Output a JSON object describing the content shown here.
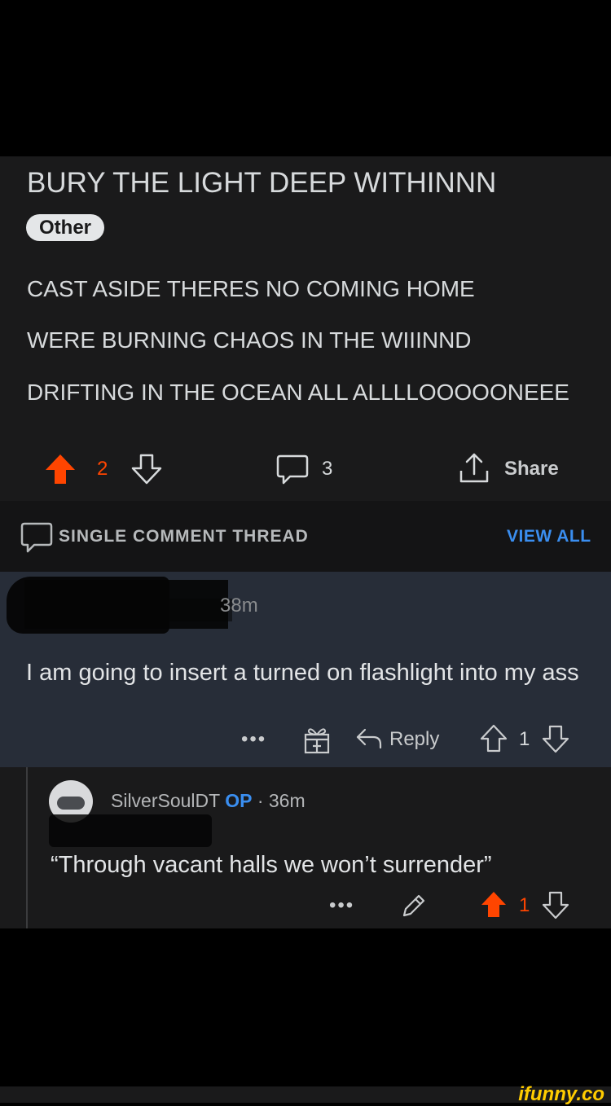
{
  "post": {
    "title": "BURY THE LIGHT DEEP WITHINNN",
    "flair": "Other",
    "lines": [
      "CAST ASIDE THERES NO COMING HOME",
      "WERE BURNING CHAOS IN THE WIIINND",
      "DRIFTING IN THE OCEAN ALL ALLLLOOOOONEEE"
    ],
    "score": "2",
    "comments": "3",
    "share_label": "Share"
  },
  "thread": {
    "label": "SINGLE COMMENT THREAD",
    "view_all": "VIEW ALL"
  },
  "comment1": {
    "time": "38m",
    "text": "I am going to insert a turned on flashlight into my ass",
    "reply_label": "Reply",
    "score": "1"
  },
  "comment2": {
    "username": "SilverSoulDT",
    "op_badge": "OP",
    "separator": "·",
    "time": "36m",
    "text": "“Through vacant halls we won’t surrender”",
    "score": "1"
  },
  "watermark": "ifunny.co",
  "colors": {
    "upvote": "#ff4500",
    "link": "#3a8ef0",
    "highlight": "#272d38"
  }
}
